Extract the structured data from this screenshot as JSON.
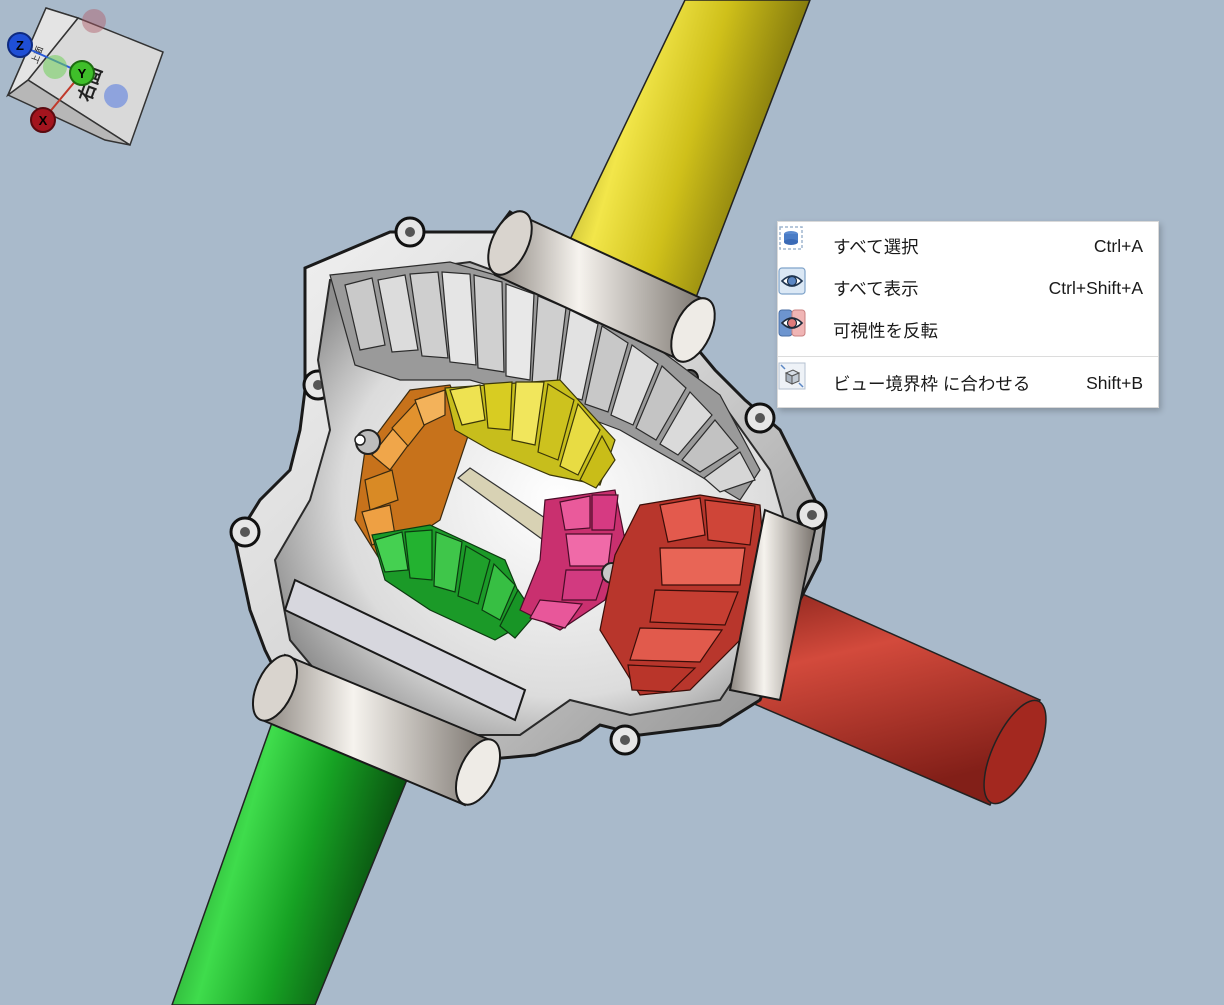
{
  "context_menu": {
    "items": [
      {
        "label": "すべて選択",
        "shortcut": "Ctrl+A",
        "icon": "select-all-icon"
      },
      {
        "label": "すべて表示",
        "shortcut": "Ctrl+Shift+A",
        "icon": "show-all-icon"
      },
      {
        "label": "可視性を反転",
        "shortcut": "",
        "icon": "toggle-visibility-icon"
      },
      {
        "label": "ビュー境界枠 に合わせる",
        "shortcut": "Shift+B",
        "icon": "fit-view-bounds-icon"
      }
    ]
  },
  "nav_cube": {
    "front_face": "右面",
    "top_face": "上面"
  },
  "axis_triad": {
    "z_label": "Z",
    "y_label": "Y",
    "x_label": "X"
  },
  "colors": {
    "background": "#a9bacb",
    "shaft_yellow": "#d8c81a",
    "shaft_green": "#19a22a",
    "shaft_red": "#b8362c",
    "gear_orange": "#d98a25",
    "gear_pink": "#d63a82",
    "gear_red": "#c94035"
  }
}
